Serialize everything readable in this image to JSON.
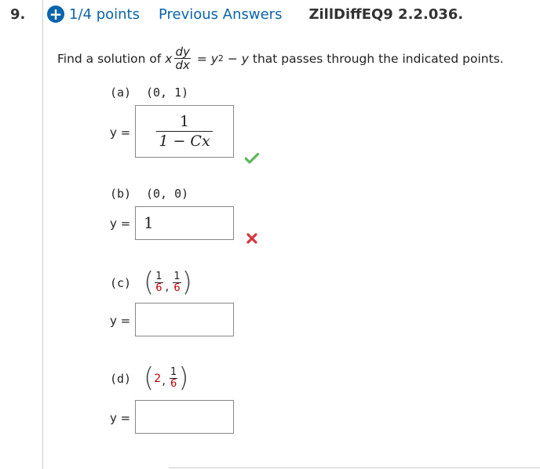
{
  "question": {
    "number": "9.",
    "points": "1/4 points",
    "previous_answers": "Previous Answers",
    "code": "ZillDiffEQ9 2.2.036."
  },
  "problem": {
    "prefix": "Find a solution of ",
    "x": "x",
    "dy": "dy",
    "dx": "dx",
    "eq": " = ",
    "y": "y",
    "exp": "2",
    "minus": " − ",
    "y2": "y",
    "suffix": " that passes through the indicated points."
  },
  "parts": [
    {
      "label": "(a)",
      "point": "(0, 1)",
      "y_label": "y =",
      "answer_num": "1",
      "answer_den": "1 − Cx",
      "status": "correct"
    },
    {
      "label": "(b)",
      "point": "(0, 0)",
      "y_label": "y =",
      "answer": "1",
      "status": "incorrect"
    },
    {
      "label": "(c)",
      "point_x_num": "1",
      "point_x_den": "6",
      "point_y_num": "1",
      "point_y_den": "6",
      "comma": ",",
      "y_label": "y =",
      "answer": ""
    },
    {
      "label": "(d)",
      "point_x": "2",
      "comma": ",",
      "point_y_num": "1",
      "point_y_den": "6",
      "y_label": "y =",
      "answer": ""
    }
  ],
  "colors": {
    "link": "#0a64ad",
    "correct": "#5cb85c",
    "incorrect": "#d9363e",
    "highlight": "#c00000"
  }
}
